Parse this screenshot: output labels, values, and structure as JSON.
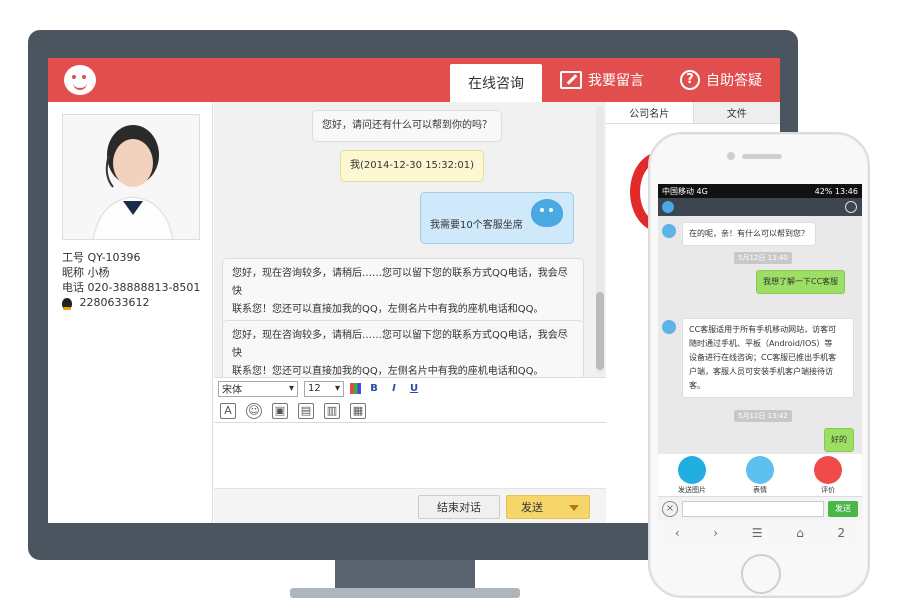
{
  "header": {
    "tabs": [
      {
        "label": "在线咨询",
        "icon": "chat-bubble-icon"
      },
      {
        "label": "我要留言",
        "icon": "edit-icon"
      },
      {
        "label": "自助答疑",
        "icon": "help-icon"
      }
    ]
  },
  "agent": {
    "id_label": "工号",
    "id_value": "QY-10396",
    "nickname_label": "昵称",
    "nickname_value": "小杨",
    "phone_label": "电话",
    "phone_value": "020-38888813-8501",
    "qq_value": "2280633612"
  },
  "chat": {
    "messages": [
      {
        "type": "system",
        "text": "您好，请问还有什么可以帮到你的吗？"
      },
      {
        "type": "timestamp",
        "text": "我(2014-12-30 15:32:01)"
      },
      {
        "type": "me",
        "text": "我需要10个客服坐席"
      },
      {
        "type": "agent",
        "text1": "您好，现在咨询较多，请稍后……您可以留下您的联系方式QQ电话，我会尽快",
        "text2": "联系您！您还可以直接加我的QQ，左侧名片中有我的座机电话和QQ。"
      },
      {
        "type": "agent",
        "text1": "您好，现在咨询较多，请稍后……您可以留下您的联系方式QQ电话，我会尽快",
        "text2": "联系您！您还可以直接加我的QQ，左侧名片中有我的座机电话和QQ。"
      }
    ],
    "toolbar": {
      "font_family": "宋体",
      "font_size": "12",
      "bold": "B",
      "italic": "I",
      "underline": "U"
    },
    "end_button": "结束对话",
    "send_button": "发送"
  },
  "right_panel": {
    "tabs": [
      "公司名片",
      "文件"
    ]
  },
  "phone": {
    "status_left": "中国移动 4G",
    "status_right": "42% 13:46",
    "messages": [
      {
        "type": "agent",
        "text": "在的呢，亲！有什么可以帮到您？"
      },
      {
        "type": "time",
        "text": "5月12日 13:40"
      },
      {
        "type": "me",
        "text": "我想了解一下CC客服"
      },
      {
        "type": "agent",
        "lines": [
          "CC客服适用于所有手机移动网站，访客可",
          "随时通过手机、平板（Android/IOS）等",
          "设备进行在线咨询；CC客服已推出手机客",
          "户端，客服人员可安装手机客户端接待访",
          "客。"
        ]
      },
      {
        "type": "time",
        "text": "5月12日 13:42"
      },
      {
        "type": "me",
        "text": "好的"
      }
    ],
    "actions": [
      {
        "label": "发送图片",
        "color": "#22aee0"
      },
      {
        "label": "表情",
        "color": "#5cc1ef"
      },
      {
        "label": "评价",
        "color": "#ef4b4b"
      }
    ],
    "send_label": "发送",
    "close_glyph": "×",
    "nav": [
      "‹",
      "›",
      "☰",
      "⌂",
      "2"
    ]
  }
}
